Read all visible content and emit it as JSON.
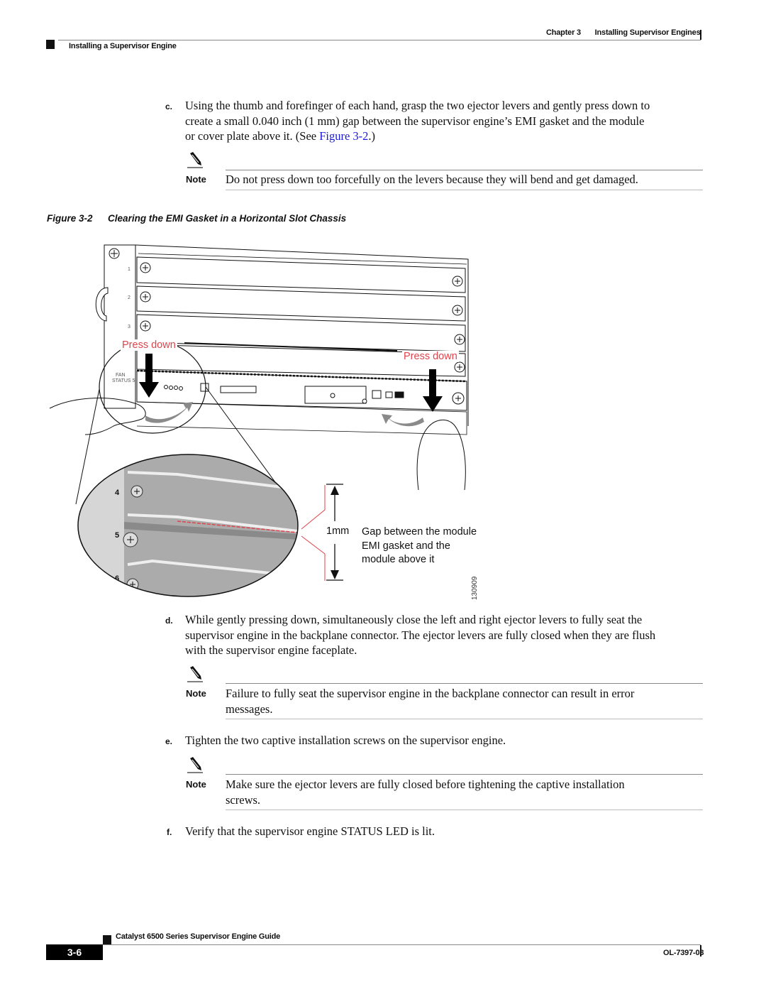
{
  "header": {
    "chapter": "Chapter 3",
    "chapter_title": "Installing Supervisor Engines",
    "section": "Installing a Supervisor Engine"
  },
  "steps": [
    {
      "letter": "c.",
      "lines": [
        "Using the thumb and forefinger of each hand, grasp the two ejector levers and gently press down to",
        "create a small 0.040 inch (1 mm) gap between the supervisor engine’s EMI gasket and the module"
      ],
      "last_line_prefix": "or cover plate above it. (See ",
      "link_text": "Figure 3-2",
      "last_line_suffix": ".)"
    },
    {
      "letter": "d.",
      "lines": [
        "While gently pressing down, simultaneously close the left and right ejector levers to fully seat the",
        "supervisor engine in the backplane connector. The ejector levers are fully closed when they are flush",
        "with the supervisor engine faceplate."
      ]
    },
    {
      "letter": "e.",
      "lines": [
        "Tighten the two captive installation screws on the supervisor engine."
      ]
    },
    {
      "letter": "f.",
      "lines": [
        "Verify that the supervisor engine STATUS LED is lit."
      ]
    }
  ],
  "notes": [
    {
      "label": "Note",
      "lines": [
        "Do not press down too forcefully on the levers because they will bend and get damaged."
      ]
    },
    {
      "label": "Note",
      "lines": [
        "Failure to fully seat the supervisor engine in the backplane connector can result in error",
        "messages."
      ]
    },
    {
      "label": "Note",
      "lines": [
        "Make sure the ejector levers are fully closed before tightening the captive installation",
        "screws."
      ]
    }
  ],
  "figure": {
    "number": "Figure 3-2",
    "title": "Clearing the EMI Gasket in a Horizontal Slot Chassis",
    "press_down_left": "Press down",
    "press_down_right": "Press down",
    "gap_measure": "1mm",
    "gap_label_lines": [
      "Gap between the module",
      "EMI gasket and the",
      "module above it"
    ],
    "art_id": "130909",
    "slot_numbers": [
      "1",
      "2",
      "3",
      "4",
      "5",
      "6"
    ],
    "panel_labels": {
      "fan": "FAN",
      "status": "STATUS"
    },
    "colors": {
      "accent_red": "#e0434a",
      "detail_gray": "#a9a9a9"
    }
  },
  "footer": {
    "doc_title": "Catalyst 6500 Series Supervisor Engine Guide",
    "page_number": "3-6",
    "doc_id": "OL-7397-03"
  }
}
